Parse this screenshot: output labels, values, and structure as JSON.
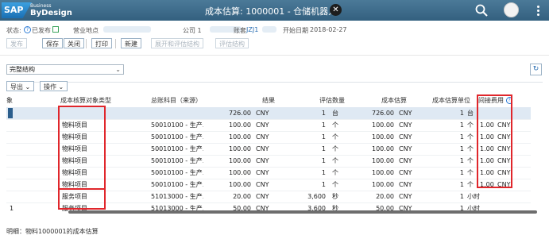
{
  "shell": {
    "logo_sap": "SAP",
    "logo_sub": "Business",
    "logo_name": "ByDesign",
    "title": "成本估算: 1000001 - 仓储机器人"
  },
  "header": {
    "status_label": "状态:",
    "status_value": "已发布",
    "site_label": "营业地点",
    "company_label": "公司 1",
    "ledger_label": "账套",
    "ledger_value": "JZJ1",
    "start_date_label": "开始日期",
    "start_date_value": "2018-02-27"
  },
  "toolbar1": {
    "publish": "发布",
    "save": "保存",
    "close": "关闭",
    "print": "打印",
    "new": "新建",
    "expand_eval": "展开和评估结构",
    "eval_structure": "评估结构"
  },
  "structure_select": {
    "value": "完整结构"
  },
  "toolbar2": {
    "export": "导出",
    "actions": "操作"
  },
  "table": {
    "columns": [
      "象",
      "成本核算对象类型",
      "总账科目（来源）",
      "结果",
      "",
      "评估数量",
      "",
      "成本估算",
      "",
      "成本估算单位",
      "间接费用",
      ""
    ],
    "rows": [
      {
        "idx": "",
        "type": "",
        "account": "",
        "result": "726.00",
        "cur": "CNY",
        "qty": "1",
        "unit": "台",
        "est": "726.00",
        "est_cur": "CNY",
        "est_unit_qty": "1",
        "est_unit": "台",
        "overhead": "",
        "oh_cur": ""
      },
      {
        "idx": "",
        "type": "物料项目",
        "account": "50010100 - 生产…",
        "result": "100.00",
        "cur": "CNY",
        "qty": "1",
        "unit": "个",
        "est": "100.00",
        "est_cur": "CNY",
        "est_unit_qty": "1",
        "est_unit": "个",
        "overhead": "1.00",
        "oh_cur": "CNY"
      },
      {
        "idx": "",
        "type": "物料项目",
        "account": "50010100 - 生产…",
        "result": "100.00",
        "cur": "CNY",
        "qty": "1",
        "unit": "个",
        "est": "100.00",
        "est_cur": "CNY",
        "est_unit_qty": "1",
        "est_unit": "个",
        "overhead": "1.00",
        "oh_cur": "CNY"
      },
      {
        "idx": "",
        "type": "物料项目",
        "account": "50010100 - 生产…",
        "result": "100.00",
        "cur": "CNY",
        "qty": "1",
        "unit": "个",
        "est": "100.00",
        "est_cur": "CNY",
        "est_unit_qty": "1",
        "est_unit": "个",
        "overhead": "1.00",
        "oh_cur": "CNY"
      },
      {
        "idx": "",
        "type": "物料项目",
        "account": "50010100 - 生产…",
        "result": "100.00",
        "cur": "CNY",
        "qty": "1",
        "unit": "个",
        "est": "100.00",
        "est_cur": "CNY",
        "est_unit_qty": "1",
        "est_unit": "个",
        "overhead": "1.00",
        "oh_cur": "CNY"
      },
      {
        "idx": "",
        "type": "物料项目",
        "account": "50010100 - 生产…",
        "result": "100.00",
        "cur": "CNY",
        "qty": "1",
        "unit": "个",
        "est": "100.00",
        "est_cur": "CNY",
        "est_unit_qty": "1",
        "est_unit": "个",
        "overhead": "1.00",
        "oh_cur": "CNY"
      },
      {
        "idx": "",
        "type": "物料项目",
        "account": "50010100 - 生产…",
        "result": "100.00",
        "cur": "CNY",
        "qty": "1",
        "unit": "个",
        "est": "100.00",
        "est_cur": "CNY",
        "est_unit_qty": "1",
        "est_unit": "个",
        "overhead": "1.00",
        "oh_cur": "CNY"
      },
      {
        "idx": "",
        "type": "服务项目",
        "account": "51013000 - 生产…",
        "result": "20.00",
        "cur": "CNY",
        "qty": "3,600",
        "unit": "秒",
        "est": "20.00",
        "est_cur": "CNY",
        "est_unit_qty": "1",
        "est_unit": "小时",
        "overhead": "",
        "oh_cur": ""
      },
      {
        "idx": "1",
        "type": "服务项目",
        "account": "51013000 - 生产…",
        "result": "50.00",
        "cur": "CNY",
        "qty": "3,600",
        "unit": "秒",
        "est": "50.00",
        "est_cur": "CNY",
        "est_unit_qty": "1",
        "est_unit": "小时",
        "overhead": "",
        "oh_cur": ""
      }
    ]
  },
  "footer": {
    "text": "明细：物料1000001的成本估算"
  },
  "colors": {
    "shell": "#3a6a8a",
    "highlight": "#e0262b",
    "selected_row": "#dfe9f3"
  }
}
